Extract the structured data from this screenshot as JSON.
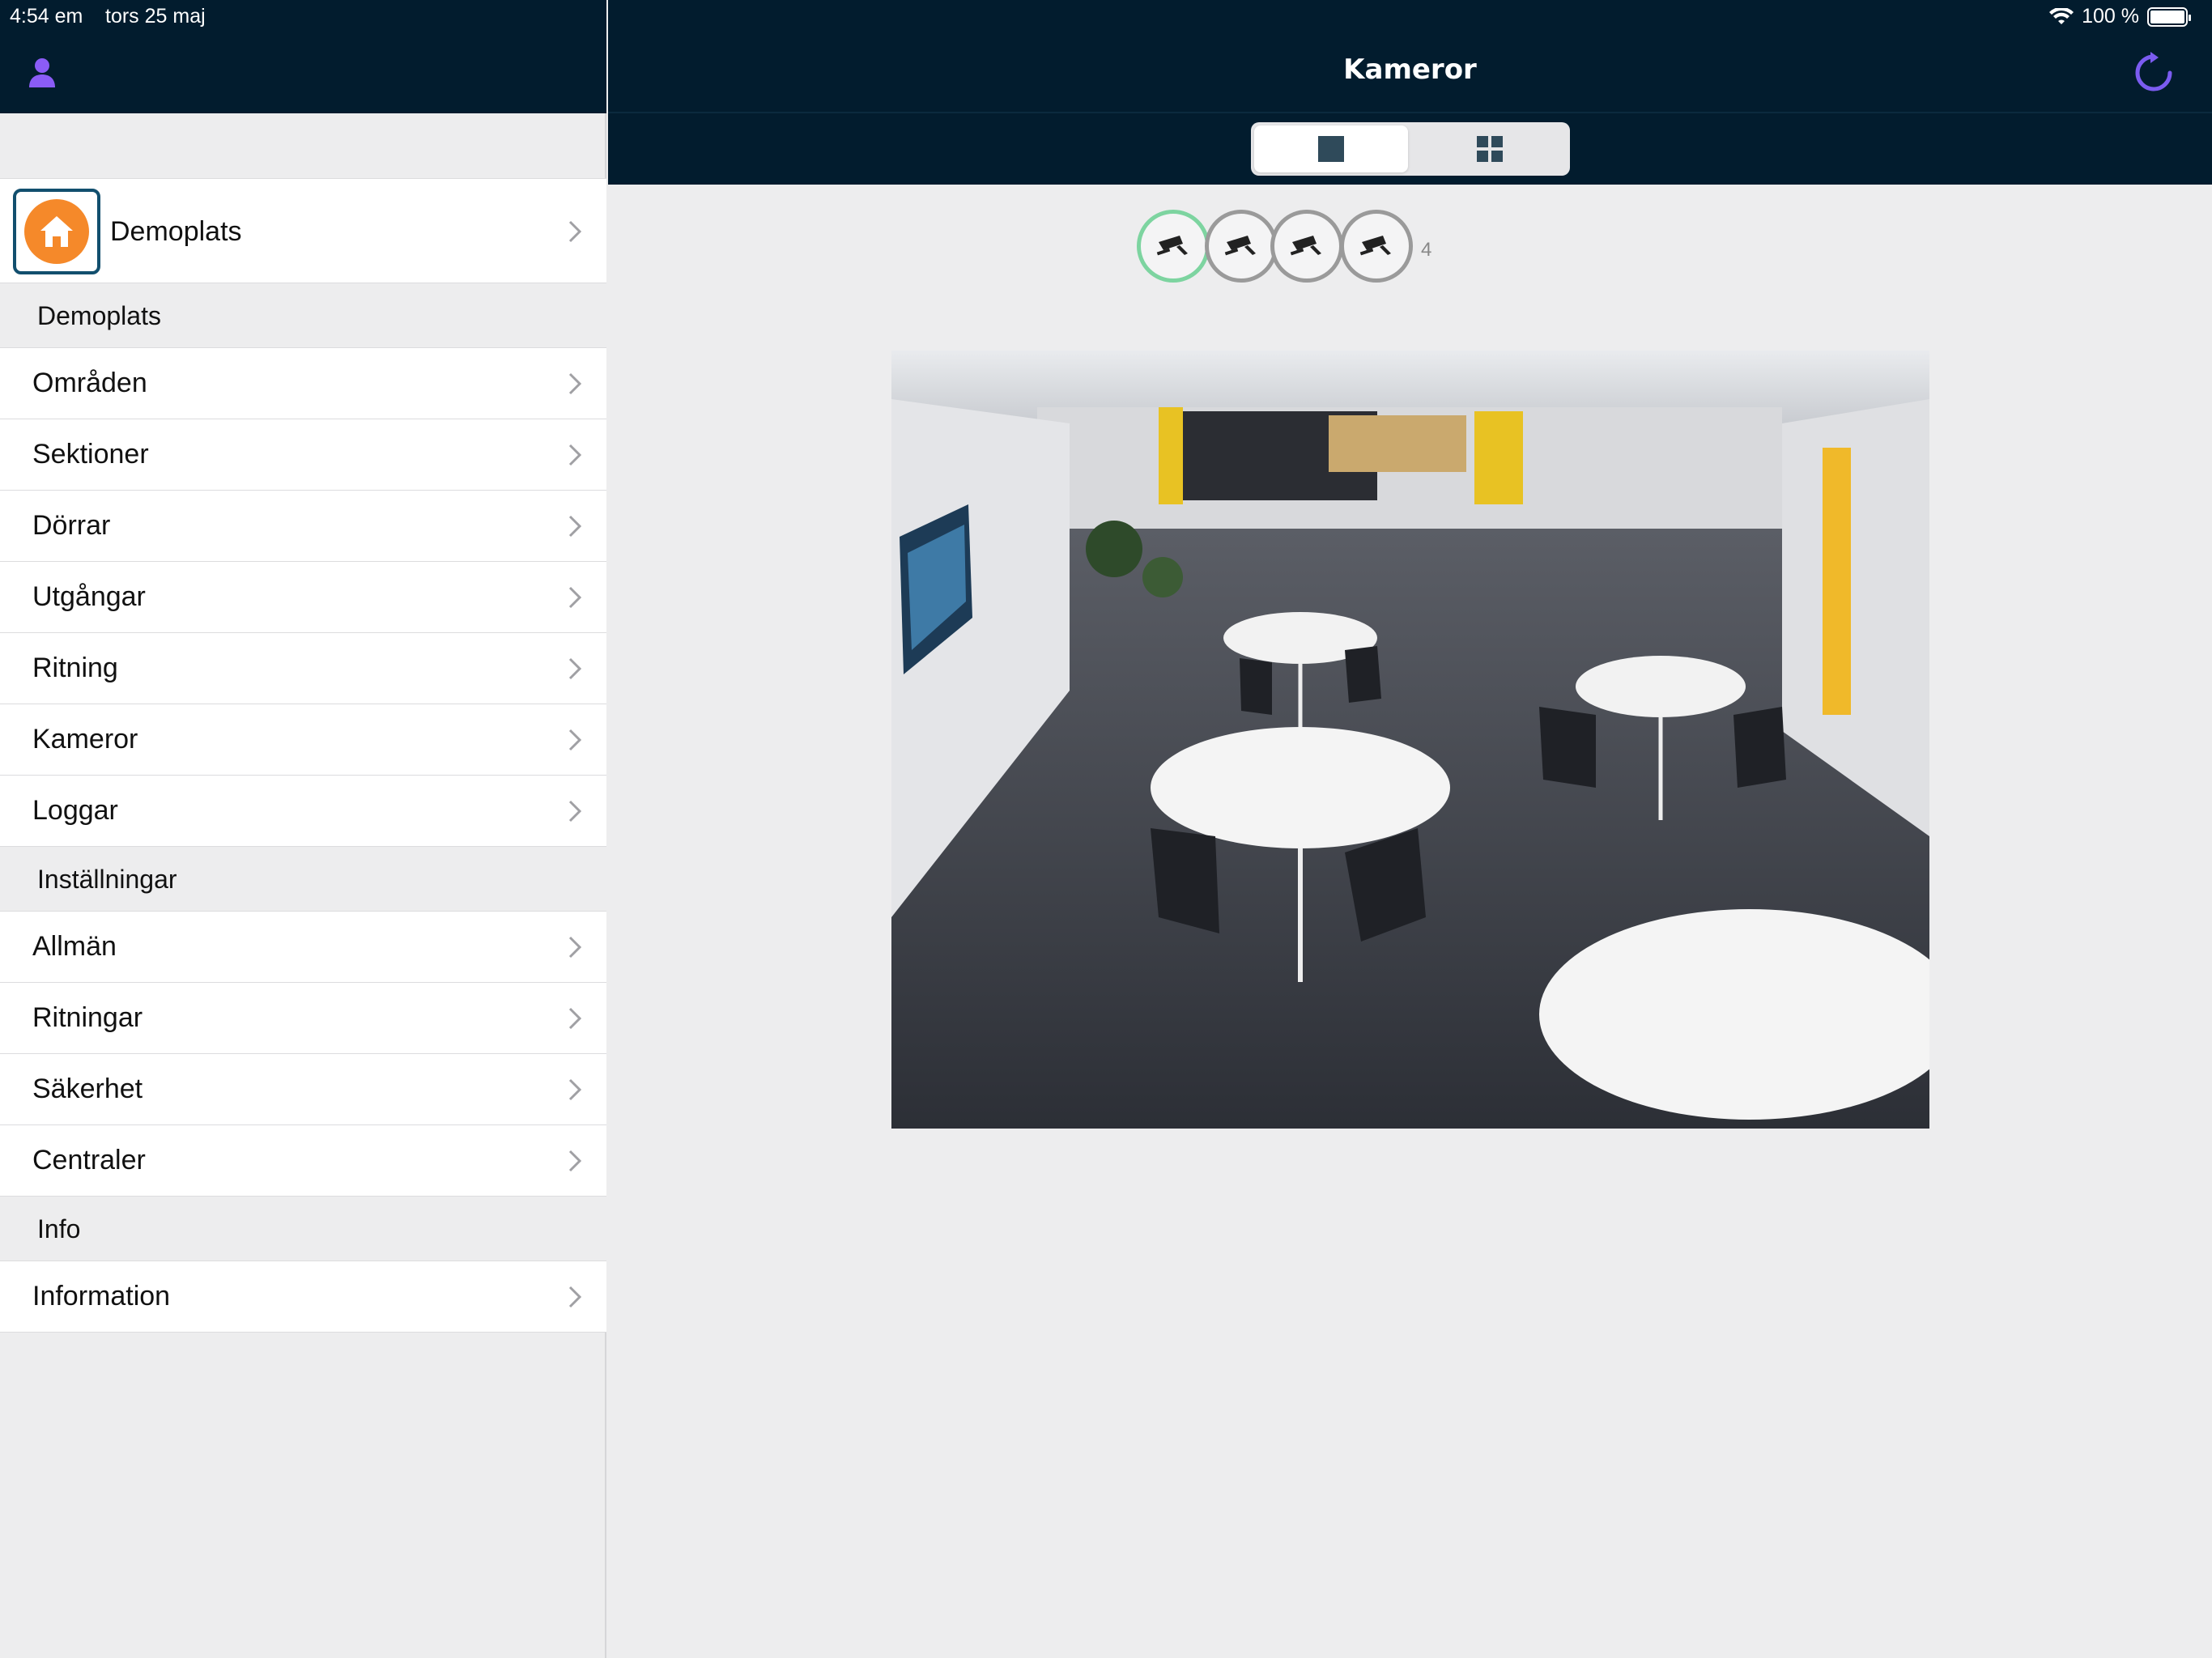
{
  "status_bar": {
    "time": "4:54 em",
    "date": "tors 25 maj",
    "battery": "100 %"
  },
  "sidebar": {
    "site": {
      "label": "Demoplats"
    },
    "sections": [
      {
        "header": "Demoplats",
        "items": [
          "Områden",
          "Sektioner",
          "Dörrar",
          "Utgångar",
          "Ritning",
          "Kameror",
          "Loggar"
        ]
      },
      {
        "header": "Inställningar",
        "items": [
          "Allmän",
          "Ritningar",
          "Säkerhet",
          "Centraler"
        ]
      },
      {
        "header": "Info",
        "items": [
          "Information"
        ]
      }
    ]
  },
  "main": {
    "title": "Kameror",
    "view_modes": [
      "single-view",
      "grid-view"
    ],
    "selected_view": "single-view",
    "cameras": [
      {
        "number": "1",
        "active": true
      },
      {
        "number": "2",
        "active": false
      },
      {
        "number": "3",
        "active": false
      },
      {
        "number": "4",
        "active": false
      }
    ]
  },
  "colors": {
    "header_bg": "#021c2e",
    "accent_purple": "#7b5cf0",
    "home_orange": "#f5892a",
    "active_camera": "#7dd4a0"
  }
}
